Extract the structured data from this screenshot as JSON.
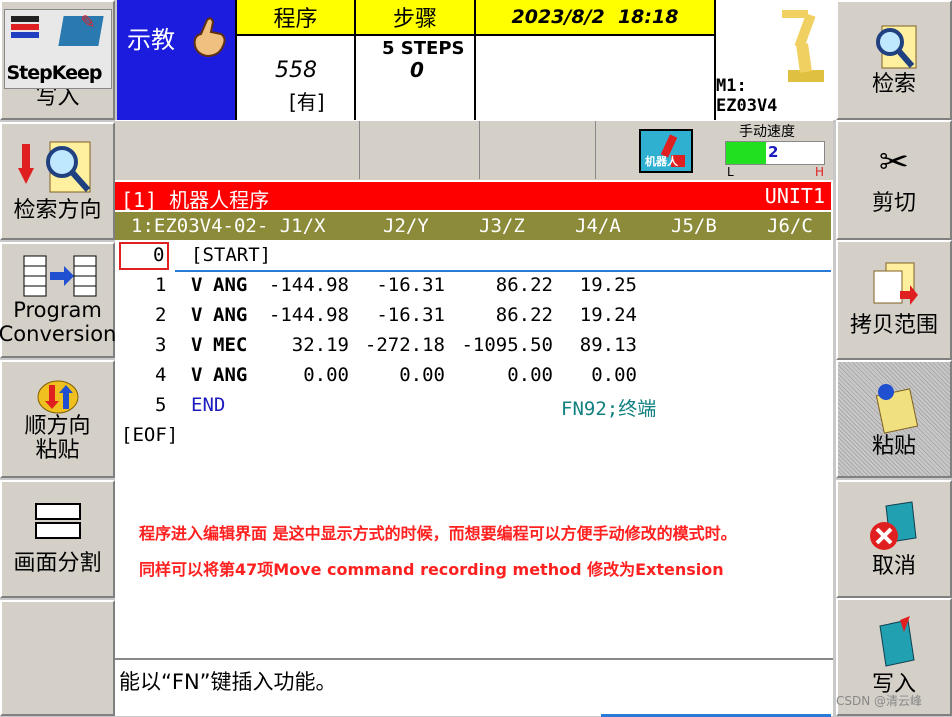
{
  "left_buttons": [
    {
      "label": "写入",
      "icon": "stepkeep-write-icon",
      "icon_text": "StepKeep"
    },
    {
      "label": "检索方向",
      "icon": "search-down-icon"
    },
    {
      "label_lines": [
        "Program",
        "Conversion"
      ],
      "icon": "program-conversion-icon"
    },
    {
      "label_lines": [
        "顺方向",
        "粘贴"
      ],
      "icon": "paste-forward-icon"
    },
    {
      "label": "画面分割",
      "icon": "split-screen-icon"
    },
    {
      "label": ""
    }
  ],
  "right_buttons": [
    {
      "label": "检索",
      "icon": "search-icon"
    },
    {
      "label": "剪切",
      "icon": "scissors-icon"
    },
    {
      "label": "拷贝范围",
      "icon": "copy-range-icon"
    },
    {
      "label": "粘贴",
      "icon": "paste-icon"
    },
    {
      "label": "取消",
      "icon": "cancel-icon"
    },
    {
      "label": "写入",
      "icon": "write-icon"
    }
  ],
  "header": {
    "mode": "示教",
    "program_label": "程序",
    "program_number": "558",
    "program_status": "[有]",
    "step_label": "步骤",
    "steps_total": "5 STEPS",
    "step_current": "0",
    "datetime": "2023/8/2  18:18",
    "machine_line1": "M1:",
    "machine_line2": "EZ03V4",
    "manual_speed_label": "手动速度",
    "manual_speed_value": "2",
    "speed_low": "L",
    "speed_high": "H",
    "robot_icon_label": "机器人"
  },
  "program": {
    "title": "[1] 机器人程序",
    "unit": "UNIT1",
    "columns": [
      "1:EZ03V4-02- J1/X",
      "J2/Y",
      "J3/Z",
      "J4/A",
      "J5/B",
      "J6/C"
    ],
    "start_line": {
      "num": "0",
      "text": "[START]"
    },
    "rows": [
      {
        "num": "1",
        "flag": "V",
        "cmd": "ANG",
        "j1": "-144.98",
        "j2": "-16.31",
        "j3": "86.22",
        "j4": "19.25"
      },
      {
        "num": "2",
        "flag": "V",
        "cmd": "ANG",
        "j1": "-144.98",
        "j2": "-16.31",
        "j3": "86.22",
        "j4": "19.24"
      },
      {
        "num": "3",
        "flag": "V",
        "cmd": "MEC",
        "j1": "32.19",
        "j2": "-272.18",
        "j3": "-1095.50",
        "j4": "89.13"
      },
      {
        "num": "4",
        "flag": "V",
        "cmd": "ANG",
        "j1": "0.00",
        "j2": "0.00",
        "j3": "0.00",
        "j4": "0.00"
      }
    ],
    "end_line": {
      "num": "5",
      "text": "END",
      "comment": "FN92;终端"
    },
    "eof": "[EOF]"
  },
  "annotation": {
    "line1": "程序进入编辑界面 是这中显示方式的时候，而想要编程可以方便手动修改的模式时。",
    "line2": "同样可以将第47项Move command recording method 修改为Extension"
  },
  "status_message": "能以“FN”键插入功能。",
  "watermark": "CSDN @清云峰",
  "colors": {
    "mode_bg": "#1c1cde",
    "header_yellow": "#ffff00",
    "title_red": "#ff0000",
    "column_header_bg": "#8b8b3a",
    "annotation_red": "#ff2020",
    "end_text_blue": "#1c1cbe",
    "comment_teal": "#108080",
    "speed_green": "#20e020"
  }
}
